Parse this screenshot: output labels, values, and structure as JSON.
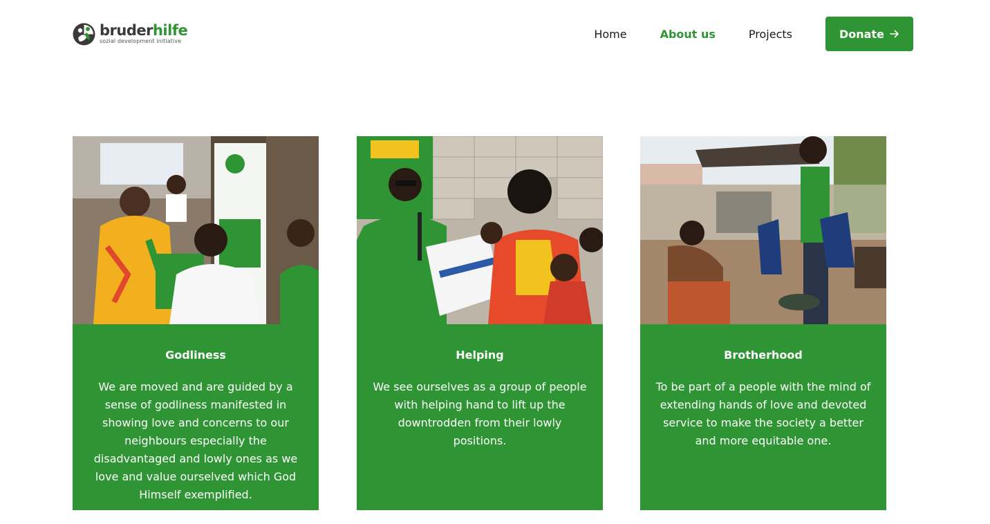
{
  "brand": {
    "name_part1": "bruder",
    "name_part2": "hilfe",
    "tagline": "sozial development initiative",
    "colors": {
      "primary_green": "#2f9534",
      "dark_text": "#1a1a1a"
    }
  },
  "nav": {
    "items": [
      {
        "label": "Home",
        "active": false
      },
      {
        "label": "About us",
        "active": true
      },
      {
        "label": "Projects",
        "active": false
      }
    ],
    "donate_label": "Donate",
    "donate_icon": "arrow-right-icon"
  },
  "cards": [
    {
      "title": "Godliness",
      "text": "We are moved and are guided by a sense of godliness manifested in showing love and concerns to our neighbours especially the disadvantaged and lowly ones as we love and value ourselved which God Himself exemplified."
    },
    {
      "title": "Helping",
      "text": "We see ourselves as a group of people with helping hand to lift up the downtrodden from their lowly positions."
    },
    {
      "title": "Brotherhood",
      "text": "To be part of a people with the mind of extending hands of love and devoted service to make the society a better and more equitable one."
    }
  ]
}
